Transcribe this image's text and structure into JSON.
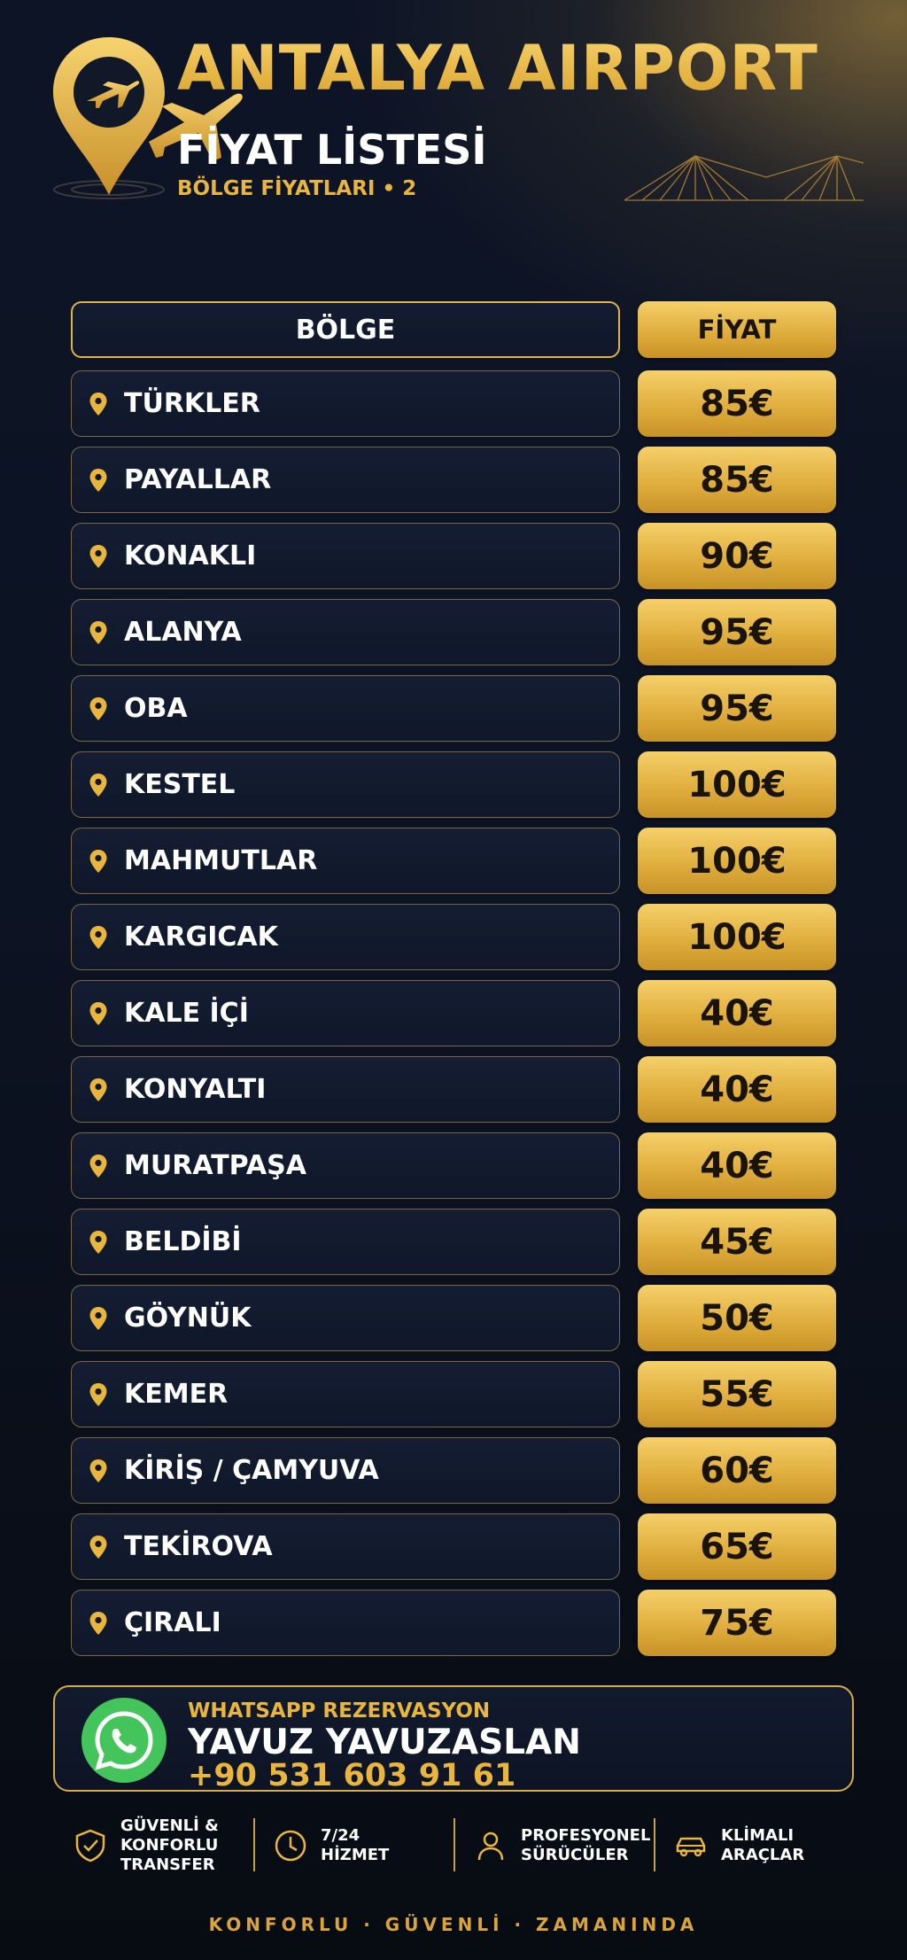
{
  "header": {
    "title": "ANTALYA AIRPORT",
    "subtitle": "FİYAT LİSTESİ",
    "tagline": "BÖLGE FİYATLARI • 2"
  },
  "table": {
    "region_header": "BÖLGE",
    "price_header": "FİYAT",
    "rows": [
      {
        "region": "TÜRKLER",
        "price": "85€"
      },
      {
        "region": "PAYALLAR",
        "price": "85€"
      },
      {
        "region": "KONAKLI",
        "price": "90€"
      },
      {
        "region": "ALANYA",
        "price": "95€"
      },
      {
        "region": "OBA",
        "price": "95€"
      },
      {
        "region": "KESTEL",
        "price": "100€"
      },
      {
        "region": "MAHMUTLAR",
        "price": "100€"
      },
      {
        "region": "KARGICAK",
        "price": "100€"
      },
      {
        "region": "KALE İÇİ",
        "price": "40€"
      },
      {
        "region": "KONYALTI",
        "price": "40€"
      },
      {
        "region": "MURATPAŞA",
        "price": "40€"
      },
      {
        "region": "BELDİBİ",
        "price": "45€"
      },
      {
        "region": "GÖYNÜK",
        "price": "50€"
      },
      {
        "region": "KEMER",
        "price": "55€"
      },
      {
        "region": "KİRİŞ / ÇAMYUVA",
        "price": "60€"
      },
      {
        "region": "TEKİROVA",
        "price": "65€"
      },
      {
        "region": "ÇIRALI",
        "price": "75€"
      }
    ]
  },
  "contact": {
    "label": "WHATSAPP REZERVASYON",
    "name": "YAVUZ YAVUZASLAN",
    "phone": "+90 531 603 91 61",
    "icon": "whatsapp-icon"
  },
  "features": [
    {
      "text": "GÜVENLİ &\nKONFORLU\nTRANSFER",
      "icon": "shield-check-icon"
    },
    {
      "text": "7/24\nHİZMET",
      "icon": "clock-icon"
    },
    {
      "text": "PROFESYONEL\nSÜRÜCÜLER",
      "icon": "user-icon"
    },
    {
      "text": "KLİMALI\nARAÇLAR",
      "icon": "car-icon"
    }
  ],
  "footer": "KONFORLU · GÜVENLİ · ZAMANINDA",
  "colors": {
    "gold": "#e8b53e",
    "background": "#0b1120",
    "whatsapp_green": "#43c55b"
  }
}
